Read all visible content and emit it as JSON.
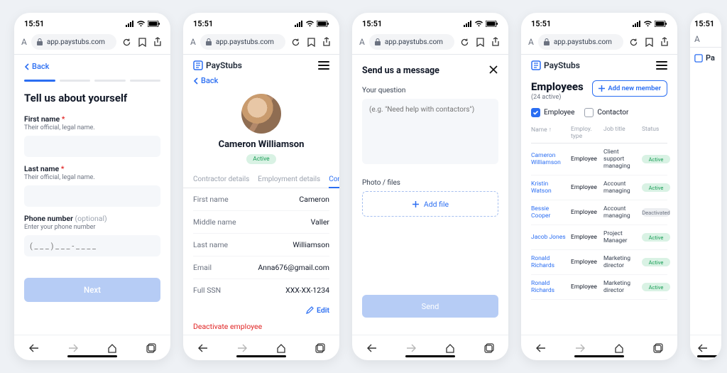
{
  "status_time": "15:51",
  "browser": {
    "url": "app.paystubs.com"
  },
  "brand": "PayStubs",
  "common": {
    "back": "Back"
  },
  "s1": {
    "title": "Tell us about yourself",
    "fields": {
      "first": {
        "label": "First name",
        "help": "Their official, legal name."
      },
      "last": {
        "label": "Last name",
        "help": "Their official, legal name."
      },
      "phone": {
        "label": "Phone number",
        "opt": "(optional)",
        "help": "Enter your phone number",
        "placeholder": "( _ _ _ ) _ _ _ - _ _ _ _"
      }
    },
    "next": "Next"
  },
  "s2": {
    "name": "Cameron Williamson",
    "status": "Active",
    "tabs": [
      "Contractor details",
      "Employment details",
      "Compen"
    ],
    "first": {
      "k": "First name",
      "v": "Cameron"
    },
    "middle": {
      "k": "Middle name",
      "v": "Valler"
    },
    "last": {
      "k": "Last name",
      "v": "Williamson"
    },
    "email": {
      "k": "Email",
      "v": "Anna676@gmail.com"
    },
    "ssn": {
      "k": "Full SSN",
      "v": "XXX-XX-1234"
    },
    "edit": "Edit",
    "deactivate": "Deactivate employee"
  },
  "s3": {
    "title": "Send us a message",
    "q_label": "Your question",
    "q_placeholder": "(e.g. \"Need help with contactors\")",
    "files_label": "Photo / files",
    "add_file": "Add file",
    "send": "Send"
  },
  "s4": {
    "heading": "Employees",
    "subtitle": "(24 active)",
    "add": "Add new member",
    "filters": {
      "employee": "Employee",
      "contactor": "Contactor"
    },
    "cols": {
      "name": "Name",
      "type": "Employ. type",
      "job": "Job title",
      "status": "Status"
    },
    "rows": [
      {
        "name": "Cameron Williamson",
        "type": "Employee",
        "job": "Client support managing",
        "status": "Active"
      },
      {
        "name": "Kristin Watson",
        "type": "Employee",
        "job": "Account managing",
        "status": "Active"
      },
      {
        "name": "Bessie Cooper",
        "type": "Employee",
        "job": "Account managing",
        "status": "Deactivated"
      },
      {
        "name": "Jacob Jones",
        "type": "Employee",
        "job": "Project Manager",
        "status": "Active"
      },
      {
        "name": "Ronald Richards",
        "type": "Employee",
        "job": "Marketing director",
        "status": "Active"
      },
      {
        "name": "Ronald Richards",
        "type": "Employee",
        "job": "Marketing director",
        "status": "Active"
      }
    ]
  }
}
